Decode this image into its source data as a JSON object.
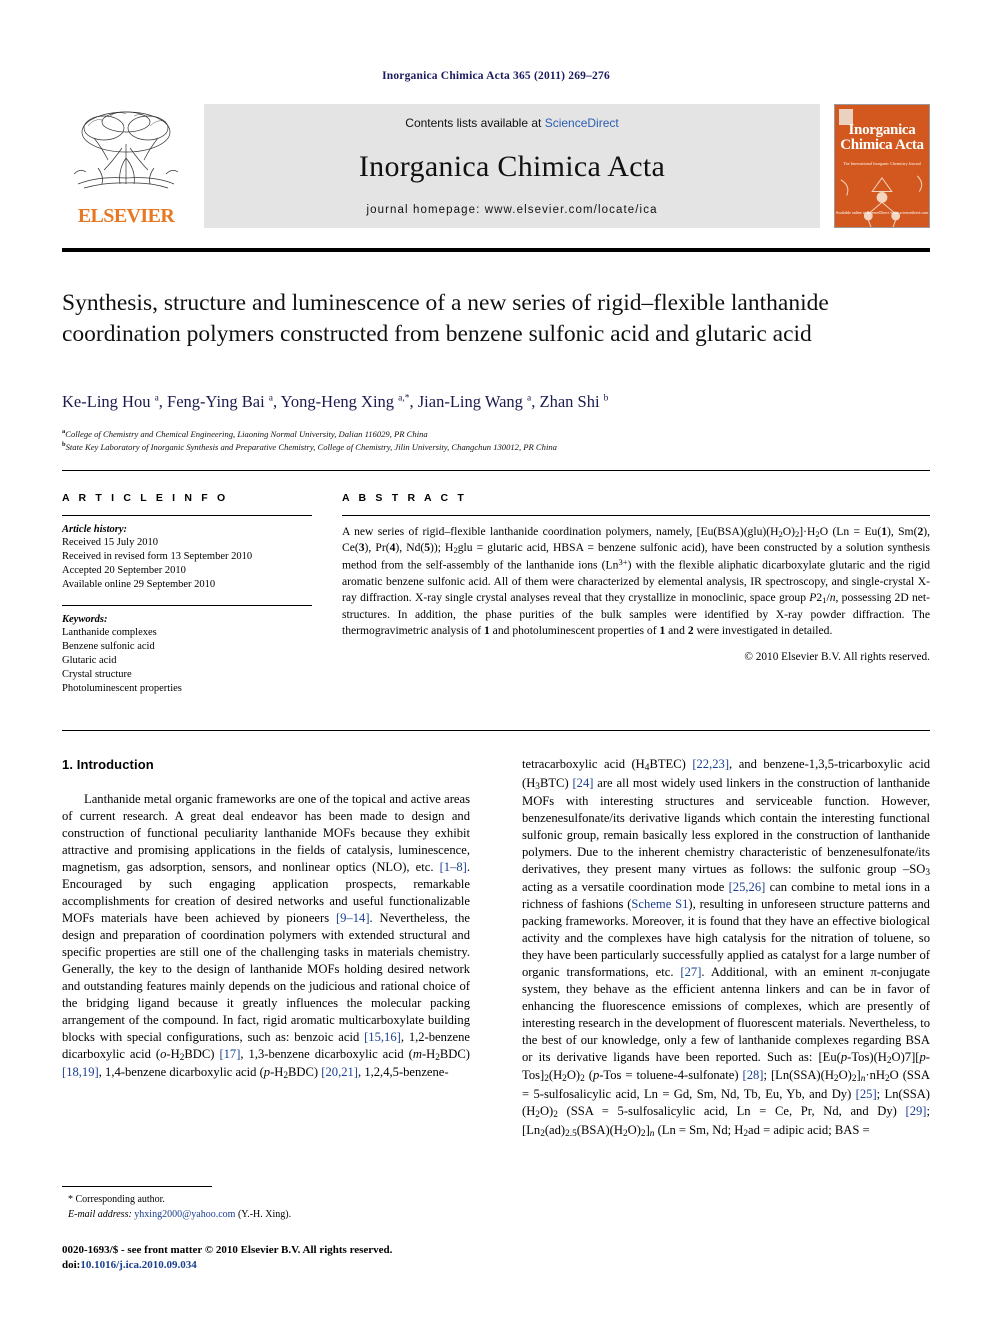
{
  "running_head": "Inorganica Chimica Acta 365 (2011) 269–276",
  "masthead": {
    "publisher": "ELSEVIER",
    "contents_prefix": "Contents lists available at ",
    "contents_link": "ScienceDirect",
    "journal_title": "Inorganica Chimica Acta",
    "homepage": "journal homepage: www.elsevier.com/locate/ica",
    "cover": {
      "line1": "Inorganica",
      "line2": "Chimica",
      "line3": "Acta",
      "subtitle": "The International Inorganic Chemistry Journal",
      "badge": "Available online at ScienceDirect  www.sciencedirect.com"
    }
  },
  "article": {
    "title": "Synthesis, structure and luminescence of a new series of rigid–flexible lanthanide coordination polymers constructed from benzene sulfonic acid and glutaric acid",
    "authors_html": "Ke-Ling Hou <sup>a</sup>, Feng-Ying Bai <sup>a</sup>, Yong-Heng Xing <sup>a,*</sup>, Jian-Ling Wang <sup>a</sup>, Zhan Shi <sup>b</sup>",
    "affiliation_a": "College of Chemistry and Chemical Engineering, Liaoning Normal University, Dalian 116029, PR China",
    "affiliation_b": "State Key Laboratory of Inorganic Synthesis and Preparative Chemistry, College of Chemistry, Jilin University, Changchun 130012, PR China"
  },
  "info": {
    "heading": "A R T I C L E   I N F O",
    "history_label": "Article history:",
    "history": [
      "Received 15 July 2010",
      "Received in revised form 13 September 2010",
      "Accepted 20 September 2010",
      "Available online 29 September 2010"
    ],
    "keywords_label": "Keywords:",
    "keywords": [
      "Lanthanide complexes",
      "Benzene sulfonic acid",
      "Glutaric acid",
      "Crystal structure",
      "Photoluminescent properties"
    ]
  },
  "abstract": {
    "heading": "A B S T R A C T",
    "body_html": "A new series of rigid–flexible lanthanide coordination polymers, namely, [Eu(BSA)(glu)(H<sub>2</sub>O)<sub>2</sub>]·H<sub>2</sub>O (Ln = Eu(<b>1</b>), Sm(<b>2</b>), Ce(<b>3</b>), Pr(<b>4</b>), Nd(<b>5</b>)); H<sub>2</sub>glu = glutaric acid, HBSA = benzene sulfonic acid), have been constructed by a solution synthesis method from the self-assembly of the lanthanide ions (Ln<sup>3+</sup>) with the flexible aliphatic dicarboxylate glutaric and the rigid aromatic benzene sulfonic acid. All of them were characterized by elemental analysis, IR spectroscopy, and single-crystal X-ray diffraction. X-ray single crystal analyses reveal that they crystallize in monoclinic, space group <i>P</i>2<sub>1</sub>/<i>n</i>, possessing 2D net-structures. In addition, the phase purities of the bulk samples were identified by X-ray powder diffraction. The thermogravimetric analysis of <b>1</b> and photoluminescent properties of <b>1</b> and <b>2</b> were investigated in detailed.",
    "copyright": "© 2010 Elsevier B.V. All rights reserved."
  },
  "body": {
    "section_heading": "1. Introduction",
    "left_html": "Lanthanide metal organic frameworks are one of the topical and active areas of current research. A great deal endeavor has been made to design and construction of functional peculiarity lanthanide MOFs because they exhibit attractive and promising applications in the fields of catalysis, luminescence, magnetism, gas adsorption, sensors, and nonlinear optics (NLO), etc. <span class=\"ref\">[1–8]</span>. Encouraged by such engaging application prospects, remarkable accomplishments for creation of desired networks and useful functionalizable MOFs materials have been achieved by pioneers <span class=\"ref\">[9–14]</span>. Nevertheless, the design and preparation of coordination polymers with extended structural and specific properties are still one of the challenging tasks in materials chemistry. Generally, the key to the design of lanthanide MOFs holding desired network and outstanding features mainly depends on the judicious and rational choice of the bridging ligand because it greatly influences the molecular packing arrangement of the compound. In fact, rigid aromatic multicarboxylate building blocks with special configurations, such as: benzoic acid <span class=\"ref\">[15,16]</span>, 1,2-benzene dicarboxylic acid (<i>o</i>-H<sub>2</sub>BDC) <span class=\"ref\">[17]</span>, 1,3-benzene dicarboxylic acid (<i>m</i>-H<sub>2</sub>BDC) <span class=\"ref\">[18,19]</span>, 1,4-benzene dicarboxylic acid (<i>p</i>-H<sub>2</sub>BDC) <span class=\"ref\">[20,21]</span>, 1,2,4,5-benzene-",
    "right_html": "tetracarboxylic acid (H<sub>4</sub>BTEC) <span class=\"ref\">[22,23]</span>, and benzene-1,3,5-tricarboxylic acid (H<sub>3</sub>BTC) <span class=\"ref\">[24]</span> are all most widely used linkers in the construction of lanthanide MOFs with interesting structures and serviceable function. However, benzenesulfonate/its derivative ligands which contain the interesting functional sulfonic group, remain basically less explored in the construction of lanthanide polymers. Due to the inherent chemistry characteristic of benzenesulfonate/its derivatives, they present many virtues as follows: the sulfonic group –SO<sub>3</sub> acting as a versatile coordination mode <span class=\"ref\">[25,26]</span> can combine to metal ions in a richness of fashions (<span class=\"ref\">Scheme S1</span>), resulting in unforeseen structure patterns and packing frameworks. Moreover, it is found that they have an effective biological activity and the complexes have high catalysis for the nitration of toluene, so they have been particularly successfully applied as catalyst for a large number of organic transformations, etc. <span class=\"ref\">[27]</span>. Additional, with an eminent π-conjugate system, they behave as the efficient antenna linkers and can be in favor of enhancing the fluorescence emissions of complexes, which are presently of interesting research in the development of fluorescent materials. Nevertheless, to the best of our knowledge, only a few of lanthanide complexes regarding BSA or its derivative ligands have been reported. Such as: [Eu(<i>p</i>-Tos)(H<sub>2</sub>O)7][<i>p</i>-Tos]<sub>2</sub>(H<sub>2</sub>O)<sub>2</sub> (<i>p</i>-Tos = toluene-4-sulfonate) <span class=\"ref\">[28]</span>; [Ln(SSA)(H<sub>2</sub>O)<sub>2</sub>]<sub><i>n</i></sub>·nH<sub>2</sub>O (SSA = 5-sulfosalicylic acid, Ln = Gd, Sm, Nd, Tb, Eu, Yb, and Dy) <span class=\"ref\">[25]</span>; Ln(SSA)(H<sub>2</sub>O)<sub>2</sub> (SSA = 5-sulfosalicylic acid, Ln = Ce, Pr, Nd, and Dy) <span class=\"ref\">[29]</span>; [Ln<sub>2</sub>(ad)<sub>2.5</sub>(BSA)(H<sub>2</sub>O)<sub>2</sub>]<sub><i>n</i></sub> (Ln = Sm, Nd; H<sub>2</sub>ad = adipic acid; BAS ="
  },
  "footer": {
    "corresponding_marker": "*",
    "corresponding_text": "Corresponding author.",
    "email_label": "E-mail address:",
    "email": "yhxing2000@yahoo.com",
    "email_owner": "(Y.-H. Xing).",
    "issn_line": "0020-1693/$ - see front matter © 2010 Elsevier B.V. All rights reserved.",
    "doi_label": "doi:",
    "doi": "10.1016/j.ica.2010.09.034"
  },
  "colors": {
    "link": "#1a3f8f",
    "running_head": "#1a1a5e",
    "elsevier_orange": "#E87722",
    "cover_bg": "#d2581f",
    "banner_bg": "#e4e4e4"
  }
}
